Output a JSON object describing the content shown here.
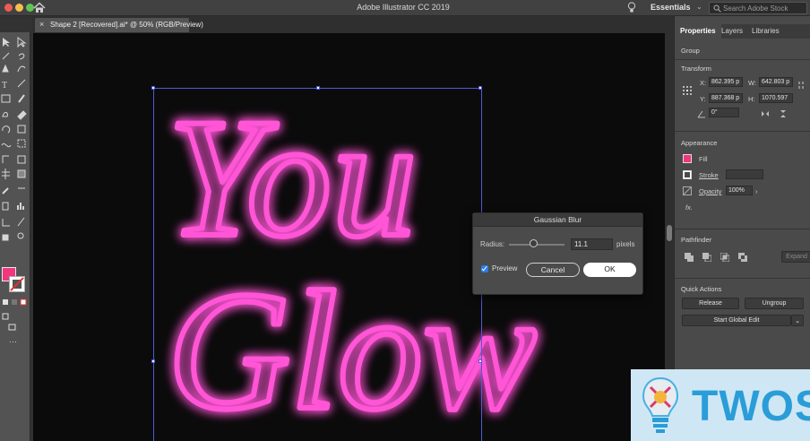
{
  "window": {
    "title": "Adobe Illustrator CC 2019"
  },
  "header": {
    "workspace": "Essentials",
    "search_placeholder": "Search Adobe Stock"
  },
  "document_tab": {
    "label": "Shape 2 [Recovered].ai* @ 50% (RGB/Preview)",
    "close": "×"
  },
  "artwork": {
    "line1": "You",
    "line2": "Glow",
    "neon_color": "#ff55d6"
  },
  "toolbar": {
    "fill_color": "#f0367f",
    "stroke_color": "#ffffff"
  },
  "dialog": {
    "title": "Gaussian Blur",
    "radius_label": "Radius:",
    "radius_value": "11.1",
    "radius_unit": "pixels",
    "radius_slider_fraction": 0.45,
    "preview_label": "Preview",
    "preview_checked": true,
    "cancel_label": "Cancel",
    "ok_label": "OK"
  },
  "panel": {
    "tabs": [
      "Properties",
      "Layers",
      "Libraries"
    ],
    "selection_type": "Group",
    "transform": {
      "heading": "Transform",
      "x_label": "X:",
      "x_value": "862.395 p",
      "y_label": "Y:",
      "y_value": "887.368 p",
      "w_label": "W:",
      "w_value": "642.803 p",
      "h_label": "H:",
      "h_value": "1070.597",
      "angle_value": "0°"
    },
    "appearance": {
      "heading": "Appearance",
      "fill_label": "Fill",
      "stroke_label": "Stroke",
      "opacity_label": "Opacity",
      "opacity_value": "100%",
      "fx_label": "fx."
    },
    "pathfinder": {
      "heading": "Pathfinder",
      "expand_label": "Expand"
    },
    "quick_actions": {
      "heading": "Quick Actions",
      "release_label": "Release",
      "ungroup_label": "Ungroup",
      "global_edit_label": "Start Global Edit"
    }
  },
  "watermark": {
    "text": "TWOS"
  }
}
